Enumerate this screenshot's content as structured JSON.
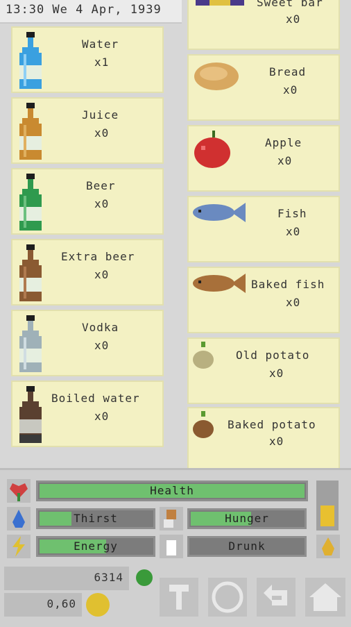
{
  "header": {
    "datetime": "13:30 We 4 Apr, 1939"
  },
  "left_items": [
    {
      "name": "Water",
      "qty": "x1",
      "icon": "water-bottle-icon",
      "color": "#3aa0e0"
    },
    {
      "name": "Juice",
      "qty": "x0",
      "icon": "juice-bottle-icon",
      "color": "#c98a30"
    },
    {
      "name": "Beer",
      "qty": "x0",
      "icon": "beer-bottle-icon",
      "color": "#2f9a4e"
    },
    {
      "name": "Extra beer",
      "qty": "x0",
      "icon": "extra-beer-bottle-icon",
      "color": "#8a5a32"
    },
    {
      "name": "Vodka",
      "qty": "x0",
      "icon": "vodka-bottle-icon",
      "color": "#9fb1b8"
    },
    {
      "name": "Boiled water",
      "qty": "x0",
      "icon": "boiled-water-bottle-icon",
      "color": "#5a4030"
    }
  ],
  "right_items": [
    {
      "name": "Sweet bar",
      "qty": "x0",
      "icon": "sweet-bar-icon"
    },
    {
      "name": "Bread",
      "qty": "x0",
      "icon": "bread-icon"
    },
    {
      "name": "Apple",
      "qty": "x0",
      "icon": "apple-icon"
    },
    {
      "name": "Fish",
      "qty": "x0",
      "icon": "fish-icon"
    },
    {
      "name": "Baked fish",
      "qty": "x0",
      "icon": "baked-fish-icon"
    },
    {
      "name": "Old potato",
      "qty": "x0",
      "icon": "old-potato-icon"
    },
    {
      "name": "Baked potato",
      "qty": "x0",
      "icon": "baked-potato-icon"
    }
  ],
  "stats": {
    "health": {
      "label": "Health",
      "level": 1.0
    },
    "thirst": {
      "label": "Thirst",
      "level": 0.3
    },
    "hunger": {
      "label": "Hunger",
      "level": 0.55
    },
    "energy": {
      "label": "Energy",
      "level": 0.6
    },
    "drunk": {
      "label": "Drunk",
      "level": 0.0
    }
  },
  "money": {
    "points": "6314",
    "coins": "0,60"
  },
  "colors": {
    "card": "#f3f1c3",
    "bar_fill": "#6fc06f",
    "panel": "#d0d0d0"
  }
}
